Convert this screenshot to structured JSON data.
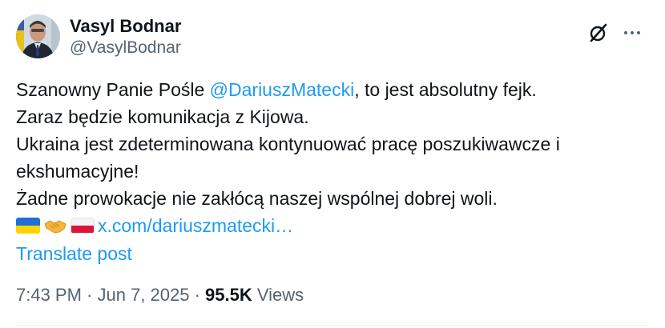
{
  "author": {
    "display_name": "Vasyl Bodnar",
    "handle": "@VasylBodnar"
  },
  "post": {
    "line1_prefix": "Szanowny Panie Pośle ",
    "mention": "@DariuszMatecki",
    "line1_suffix": ", to jest absolutny fejk.",
    "line2": "Zaraz będzie komunikacja z Kijowa.",
    "line3": "Ukraina jest zdeterminowana kontynuować pracę poszukiwawcze i",
    "line4": "ekshumacyjne!",
    "line5": "Żadne prowokacje nie zakłócą naszej wspólnej dobrej woli.",
    "emojis": [
      "flag-ukraine",
      "handshake",
      "flag-poland"
    ],
    "link": "x.com/dariuszmatecki…"
  },
  "translate_label": "Translate post",
  "meta": {
    "time": "7:43 PM",
    "separator": " · ",
    "date": "Jun 7, 2025",
    "views_count": "95.5K",
    "views_label": " Views"
  },
  "icons": {
    "grok": "grok-slash-icon",
    "more": "more-dots-icon"
  },
  "colors": {
    "link": "#1d9bf0",
    "text": "#0f1419",
    "secondary": "#536471"
  }
}
